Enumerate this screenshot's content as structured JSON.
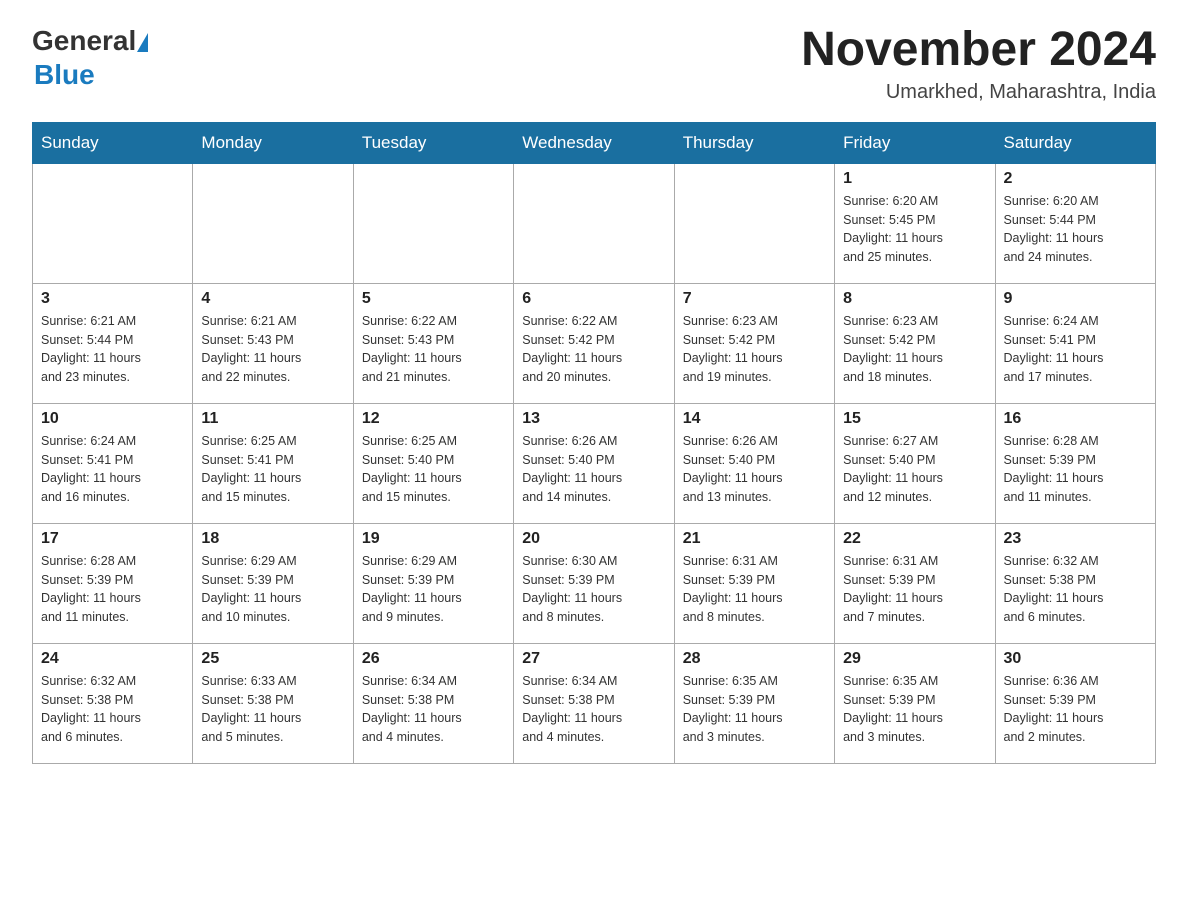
{
  "header": {
    "logo_general": "General",
    "logo_blue": "Blue",
    "month_title": "November 2024",
    "location": "Umarkhed, Maharashtra, India"
  },
  "weekdays": [
    "Sunday",
    "Monday",
    "Tuesday",
    "Wednesday",
    "Thursday",
    "Friday",
    "Saturday"
  ],
  "rows": [
    [
      {
        "day": "",
        "info": ""
      },
      {
        "day": "",
        "info": ""
      },
      {
        "day": "",
        "info": ""
      },
      {
        "day": "",
        "info": ""
      },
      {
        "day": "",
        "info": ""
      },
      {
        "day": "1",
        "info": "Sunrise: 6:20 AM\nSunset: 5:45 PM\nDaylight: 11 hours\nand 25 minutes."
      },
      {
        "day": "2",
        "info": "Sunrise: 6:20 AM\nSunset: 5:44 PM\nDaylight: 11 hours\nand 24 minutes."
      }
    ],
    [
      {
        "day": "3",
        "info": "Sunrise: 6:21 AM\nSunset: 5:44 PM\nDaylight: 11 hours\nand 23 minutes."
      },
      {
        "day": "4",
        "info": "Sunrise: 6:21 AM\nSunset: 5:43 PM\nDaylight: 11 hours\nand 22 minutes."
      },
      {
        "day": "5",
        "info": "Sunrise: 6:22 AM\nSunset: 5:43 PM\nDaylight: 11 hours\nand 21 minutes."
      },
      {
        "day": "6",
        "info": "Sunrise: 6:22 AM\nSunset: 5:42 PM\nDaylight: 11 hours\nand 20 minutes."
      },
      {
        "day": "7",
        "info": "Sunrise: 6:23 AM\nSunset: 5:42 PM\nDaylight: 11 hours\nand 19 minutes."
      },
      {
        "day": "8",
        "info": "Sunrise: 6:23 AM\nSunset: 5:42 PM\nDaylight: 11 hours\nand 18 minutes."
      },
      {
        "day": "9",
        "info": "Sunrise: 6:24 AM\nSunset: 5:41 PM\nDaylight: 11 hours\nand 17 minutes."
      }
    ],
    [
      {
        "day": "10",
        "info": "Sunrise: 6:24 AM\nSunset: 5:41 PM\nDaylight: 11 hours\nand 16 minutes."
      },
      {
        "day": "11",
        "info": "Sunrise: 6:25 AM\nSunset: 5:41 PM\nDaylight: 11 hours\nand 15 minutes."
      },
      {
        "day": "12",
        "info": "Sunrise: 6:25 AM\nSunset: 5:40 PM\nDaylight: 11 hours\nand 15 minutes."
      },
      {
        "day": "13",
        "info": "Sunrise: 6:26 AM\nSunset: 5:40 PM\nDaylight: 11 hours\nand 14 minutes."
      },
      {
        "day": "14",
        "info": "Sunrise: 6:26 AM\nSunset: 5:40 PM\nDaylight: 11 hours\nand 13 minutes."
      },
      {
        "day": "15",
        "info": "Sunrise: 6:27 AM\nSunset: 5:40 PM\nDaylight: 11 hours\nand 12 minutes."
      },
      {
        "day": "16",
        "info": "Sunrise: 6:28 AM\nSunset: 5:39 PM\nDaylight: 11 hours\nand 11 minutes."
      }
    ],
    [
      {
        "day": "17",
        "info": "Sunrise: 6:28 AM\nSunset: 5:39 PM\nDaylight: 11 hours\nand 11 minutes."
      },
      {
        "day": "18",
        "info": "Sunrise: 6:29 AM\nSunset: 5:39 PM\nDaylight: 11 hours\nand 10 minutes."
      },
      {
        "day": "19",
        "info": "Sunrise: 6:29 AM\nSunset: 5:39 PM\nDaylight: 11 hours\nand 9 minutes."
      },
      {
        "day": "20",
        "info": "Sunrise: 6:30 AM\nSunset: 5:39 PM\nDaylight: 11 hours\nand 8 minutes."
      },
      {
        "day": "21",
        "info": "Sunrise: 6:31 AM\nSunset: 5:39 PM\nDaylight: 11 hours\nand 8 minutes."
      },
      {
        "day": "22",
        "info": "Sunrise: 6:31 AM\nSunset: 5:39 PM\nDaylight: 11 hours\nand 7 minutes."
      },
      {
        "day": "23",
        "info": "Sunrise: 6:32 AM\nSunset: 5:38 PM\nDaylight: 11 hours\nand 6 minutes."
      }
    ],
    [
      {
        "day": "24",
        "info": "Sunrise: 6:32 AM\nSunset: 5:38 PM\nDaylight: 11 hours\nand 6 minutes."
      },
      {
        "day": "25",
        "info": "Sunrise: 6:33 AM\nSunset: 5:38 PM\nDaylight: 11 hours\nand 5 minutes."
      },
      {
        "day": "26",
        "info": "Sunrise: 6:34 AM\nSunset: 5:38 PM\nDaylight: 11 hours\nand 4 minutes."
      },
      {
        "day": "27",
        "info": "Sunrise: 6:34 AM\nSunset: 5:38 PM\nDaylight: 11 hours\nand 4 minutes."
      },
      {
        "day": "28",
        "info": "Sunrise: 6:35 AM\nSunset: 5:39 PM\nDaylight: 11 hours\nand 3 minutes."
      },
      {
        "day": "29",
        "info": "Sunrise: 6:35 AM\nSunset: 5:39 PM\nDaylight: 11 hours\nand 3 minutes."
      },
      {
        "day": "30",
        "info": "Sunrise: 6:36 AM\nSunset: 5:39 PM\nDaylight: 11 hours\nand 2 minutes."
      }
    ]
  ]
}
